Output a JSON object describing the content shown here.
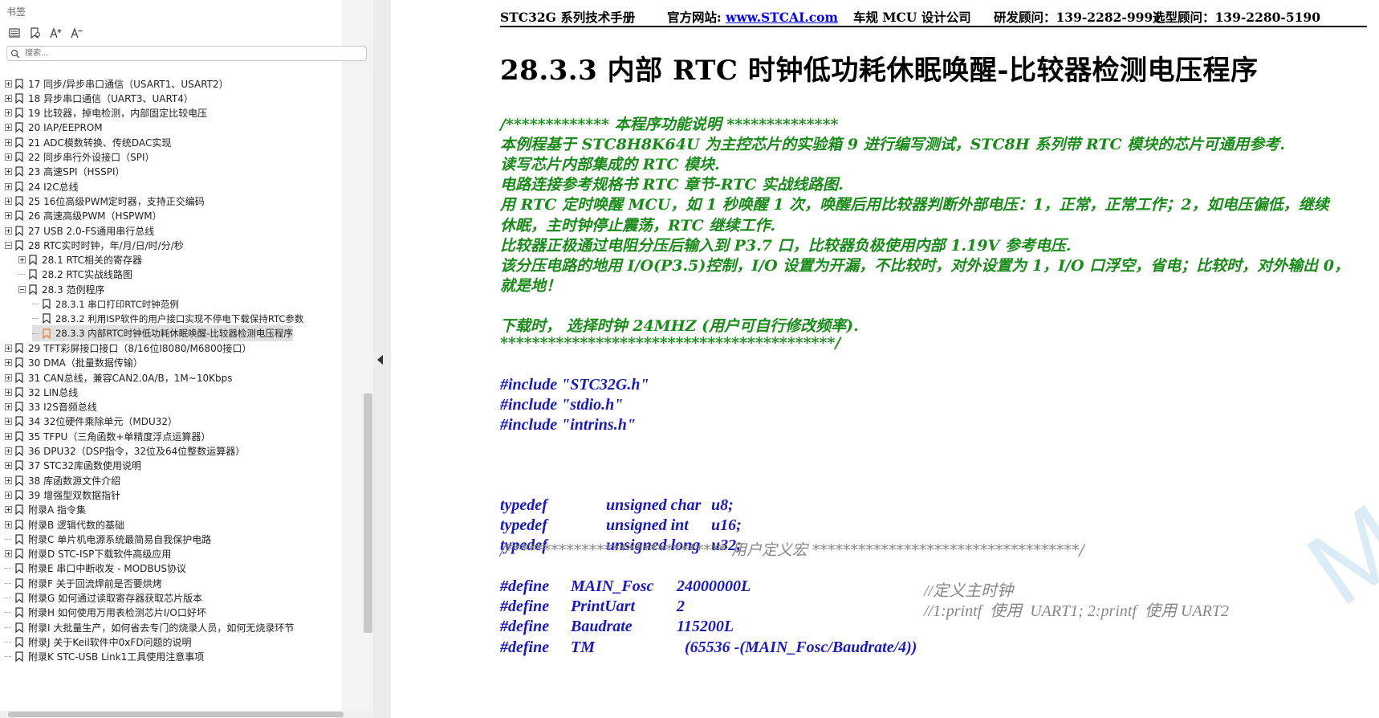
{
  "panel": {
    "title": "书签",
    "search_placeholder": "搜索...",
    "toolbar": [
      "list-icon",
      "bookmark-search-icon",
      "font-increase-icon",
      "font-decrease-icon"
    ]
  },
  "bookmarks": [
    {
      "label": "17  同步/异步串口通信（USART1、USART2）",
      "level": 0,
      "expander": "plus"
    },
    {
      "label": "18  异步串口通信（UART3、UART4）",
      "level": 0,
      "expander": "plus"
    },
    {
      "label": "19  比较器，掉电检测，内部固定比较电压",
      "level": 0,
      "expander": "plus"
    },
    {
      "label": "20  IAP/EEPROM",
      "level": 0,
      "expander": "plus"
    },
    {
      "label": "21  ADC模数转换、传统DAC实现",
      "level": 0,
      "expander": "plus"
    },
    {
      "label": "22  同步串行外设接口（SPI）",
      "level": 0,
      "expander": "plus"
    },
    {
      "label": "23  高速SPI（HSSPI）",
      "level": 0,
      "expander": "plus"
    },
    {
      "label": "24  I2C总线",
      "level": 0,
      "expander": "plus"
    },
    {
      "label": "25  16位高级PWM定时器，支持正交编码",
      "level": 0,
      "expander": "plus"
    },
    {
      "label": "26  高速高级PWM（HSPWM）",
      "level": 0,
      "expander": "plus"
    },
    {
      "label": "27  USB 2.0-FS通用串行总线",
      "level": 0,
      "expander": "plus"
    },
    {
      "label": "28  RTC实时时钟，年/月/日/时/分/秒",
      "level": 0,
      "expander": "minus"
    },
    {
      "label": "28.1  RTC相关的寄存器",
      "level": 1,
      "expander": "plus"
    },
    {
      "label": "28.2  RTC实战线路图",
      "level": 1,
      "expander": "none"
    },
    {
      "label": "28.3  范例程序",
      "level": 1,
      "expander": "minus"
    },
    {
      "label": "28.3.1  串口打印RTC时钟范例",
      "level": 2,
      "expander": "none"
    },
    {
      "label": "28.3.2  利用ISP软件的用户接口实现不停电下载保持RTC参数",
      "level": 2,
      "expander": "none"
    },
    {
      "label": "28.3.3  内部RTC时钟低功耗休眠唤醒-比较器检测电压程序",
      "level": 2,
      "expander": "none",
      "selected": true
    },
    {
      "label": "29  TFT彩屏接口接口（8/16位I8080/M6800接口）",
      "level": 0,
      "expander": "plus"
    },
    {
      "label": "30  DMA（批量数据传输）",
      "level": 0,
      "expander": "plus"
    },
    {
      "label": "31  CAN总线，兼容CAN2.0A/B，1M~10Kbps",
      "level": 0,
      "expander": "plus"
    },
    {
      "label": "32  LIN总线",
      "level": 0,
      "expander": "plus"
    },
    {
      "label": "33  I2S音频总线",
      "level": 0,
      "expander": "plus"
    },
    {
      "label": "34  32位硬件乘除单元（MDU32）",
      "level": 0,
      "expander": "plus"
    },
    {
      "label": "35  TFPU（三角函数+单精度浮点运算器）",
      "level": 0,
      "expander": "plus"
    },
    {
      "label": "36  DPU32（DSP指令，32位及64位整数运算器）",
      "level": 0,
      "expander": "plus"
    },
    {
      "label": "37  STC32库函数使用说明",
      "level": 0,
      "expander": "plus"
    },
    {
      "label": "38  库函数源文件介绍",
      "level": 0,
      "expander": "plus"
    },
    {
      "label": "39  增强型双数据指针",
      "level": 0,
      "expander": "plus"
    },
    {
      "label": "附录A  指令集",
      "level": 0,
      "expander": "plus"
    },
    {
      "label": "附录B  逻辑代数的基础",
      "level": 0,
      "expander": "plus"
    },
    {
      "label": "附录C  单片机电源系统最简易自我保护电路",
      "level": 0,
      "expander": "none"
    },
    {
      "label": "附录D  STC-ISP下载软件高级应用",
      "level": 0,
      "expander": "plus"
    },
    {
      "label": "附录E  串口中断收发 - MODBUS协议",
      "level": 0,
      "expander": "none"
    },
    {
      "label": "附录F  关于回流焊前是否要烘烤",
      "level": 0,
      "expander": "none"
    },
    {
      "label": "附录G  如何通过读取寄存器获取芯片版本",
      "level": 0,
      "expander": "none"
    },
    {
      "label": "附录H  如何使用万用表检测芯片I/O口好坏",
      "level": 0,
      "expander": "none"
    },
    {
      "label": "附录I  大批量生产，如何省去专门的烧录人员，如何无烧录环节",
      "level": 0,
      "expander": "none"
    },
    {
      "label": "附录J  关于Keil软件中0xFD问题的说明",
      "level": 0,
      "expander": "none"
    },
    {
      "label": "附录K  STC-USB Link1工具使用注意事项",
      "level": 0,
      "expander": "none"
    }
  ],
  "header": {
    "manual": "STC32G 系列技术手册",
    "website_label": "官方网站: ",
    "website": "www.STCAI.com",
    "company": "车规 MCU 设计公司",
    "rd": "研发顾问：139-2282-9991",
    "sales": "选型顾问：139-2280-5190"
  },
  "doc": {
    "title": "28.3.3  内部 RTC 时钟低功耗休眠唤醒-比较器检测电压程序",
    "watermark": "MCU",
    "comment_lines": [
      "/*************  本程序功能说明  **************",
      "本例程基于 STC8H8K64U 为主控芯片的实验箱 9 进行编写测试，STC8H 系列带 RTC 模块的芯片可通用参考.",
      "读写芯片内部集成的 RTC 模块.",
      "电路连接参考规格书 RTC 章节-RTC 实战线路图.",
      "用 RTC 定时唤醒 MCU，如 1 秒唤醒 1 次，唤醒后用比较器判断外部电压：1，正常，正常工作；2，如电压偏低，继续",
      "休眠，主时钟停止震荡，RTC 继续工作.",
      "比较器正极通过电阻分压后输入到 P3.7 口，比较器负极使用内部 1.19V 参考电压.",
      "该分压电路的地用 I/O(P3.5)控制，I/O 设置为开漏，不比较时，对外设置为 1，I/O 口浮空，省电；比较时，对外输出 0，",
      "就是地！",
      "",
      "下载时，  选择时钟  24MHZ (用户可自行修改频率).",
      "******************************************/"
    ],
    "includes": [
      "#include \"STC32G.h\"",
      "#include \"stdio.h\"",
      "#include \"intrins.h\""
    ],
    "typedefs": [
      {
        "kw": "typedef",
        "type": "unsigned char",
        "name": "u8;"
      },
      {
        "kw": "typedef",
        "type": "unsigned int",
        "name": "u16;"
      },
      {
        "kw": "typedef",
        "type": "unsigned long",
        "name": "u32;"
      }
    ],
    "macro_banner": "/*****************************  用户定义宏  ***********************************/",
    "defines": [
      {
        "kw": "#define",
        "name": "MAIN_Fosc",
        "value": "24000000L",
        "comment": "//定义主时钟"
      },
      {
        "kw": "#define",
        "name": "PrintUart",
        "value": "2",
        "comment": "//1:printf  使用  UART1; 2:printf  使用 UART2"
      },
      {
        "kw": "#define",
        "name": "Baudrate",
        "value": "115200L",
        "comment": ""
      },
      {
        "kw": "#define",
        "name": "TM",
        "value": "(65536 -(MAIN_Fosc/Baudrate/4))",
        "comment": ""
      }
    ]
  }
}
